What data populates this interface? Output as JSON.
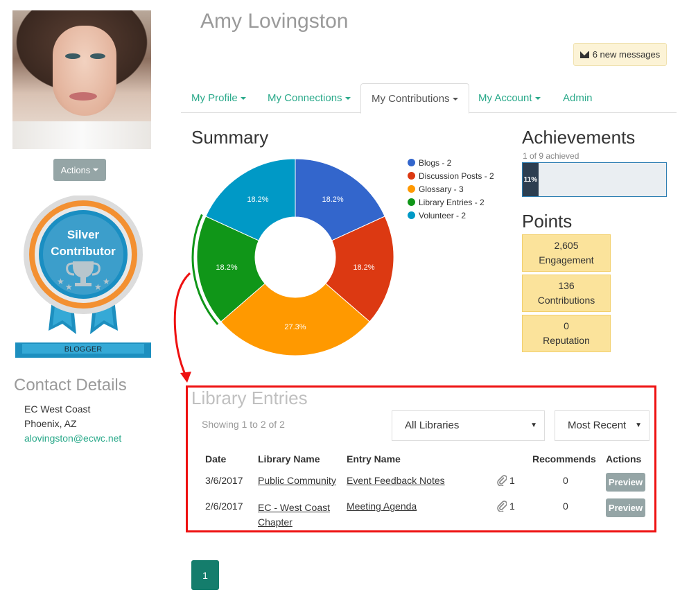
{
  "profile": {
    "name": "Amy Lovingston",
    "actions_label": "Actions",
    "badge": {
      "line1": "Silver",
      "line2": "Contributor",
      "ribbon": "BLOGGER"
    }
  },
  "contact": {
    "title": "Contact Details",
    "org": "EC West Coast",
    "location": "Phoenix, AZ",
    "email": "alovingston@ecwc.net"
  },
  "header": {
    "messages": "6 new messages",
    "messages_icon": "envelope-icon"
  },
  "tabs": [
    {
      "label": "My Profile",
      "dropdown": true
    },
    {
      "label": "My Connections",
      "dropdown": true
    },
    {
      "label": "My Contributions",
      "dropdown": true,
      "active": true
    },
    {
      "label": "My Account",
      "dropdown": true
    },
    {
      "label": "Admin",
      "dropdown": false
    }
  ],
  "summary": {
    "title": "Summary"
  },
  "chart_data": {
    "type": "pie",
    "variant": "donut",
    "labels": [
      "Blogs - 2",
      "Discussion Posts - 2",
      "Glossary - 3",
      "Library Entries - 2",
      "Volunteer - 2"
    ],
    "values": [
      2,
      2,
      3,
      2,
      2
    ],
    "percent_labels": [
      "18.2%",
      "18.2%",
      "27.3%",
      "18.2%",
      "18.2%"
    ],
    "colors": [
      "#3366cc",
      "#dc3912",
      "#ff9900",
      "#109618",
      "#0099c6"
    ],
    "legend": "right"
  },
  "achievements": {
    "title": "Achievements",
    "subtitle": "1 of 9 achieved",
    "progress_label": "11%",
    "progress": 0.11
  },
  "points": {
    "title": "Points",
    "items": [
      {
        "value": "2,605",
        "label": "Engagement"
      },
      {
        "value": "136",
        "label": "Contributions"
      },
      {
        "value": "0",
        "label": "Reputation"
      }
    ]
  },
  "library": {
    "title": "Library Entries",
    "showing": "Showing 1 to 2 of 2",
    "filter_library": "All Libraries",
    "sort": "Most Recent",
    "columns": [
      "Date",
      "Library Name",
      "Entry Name",
      "Recommends",
      "Actions"
    ],
    "rows": [
      {
        "date": "3/6/2017",
        "library": "Public Community",
        "entry": "Event Feedback Notes",
        "attachments": "1",
        "recommends": "0",
        "action": "Preview"
      },
      {
        "date": "2/6/2017",
        "library_line1": "EC - West Coast",
        "library_line2": "Chapter",
        "entry": "Meeting Agenda",
        "attachments": "1",
        "recommends": "0",
        "action": "Preview"
      }
    ]
  },
  "pagination": {
    "current": "1"
  }
}
